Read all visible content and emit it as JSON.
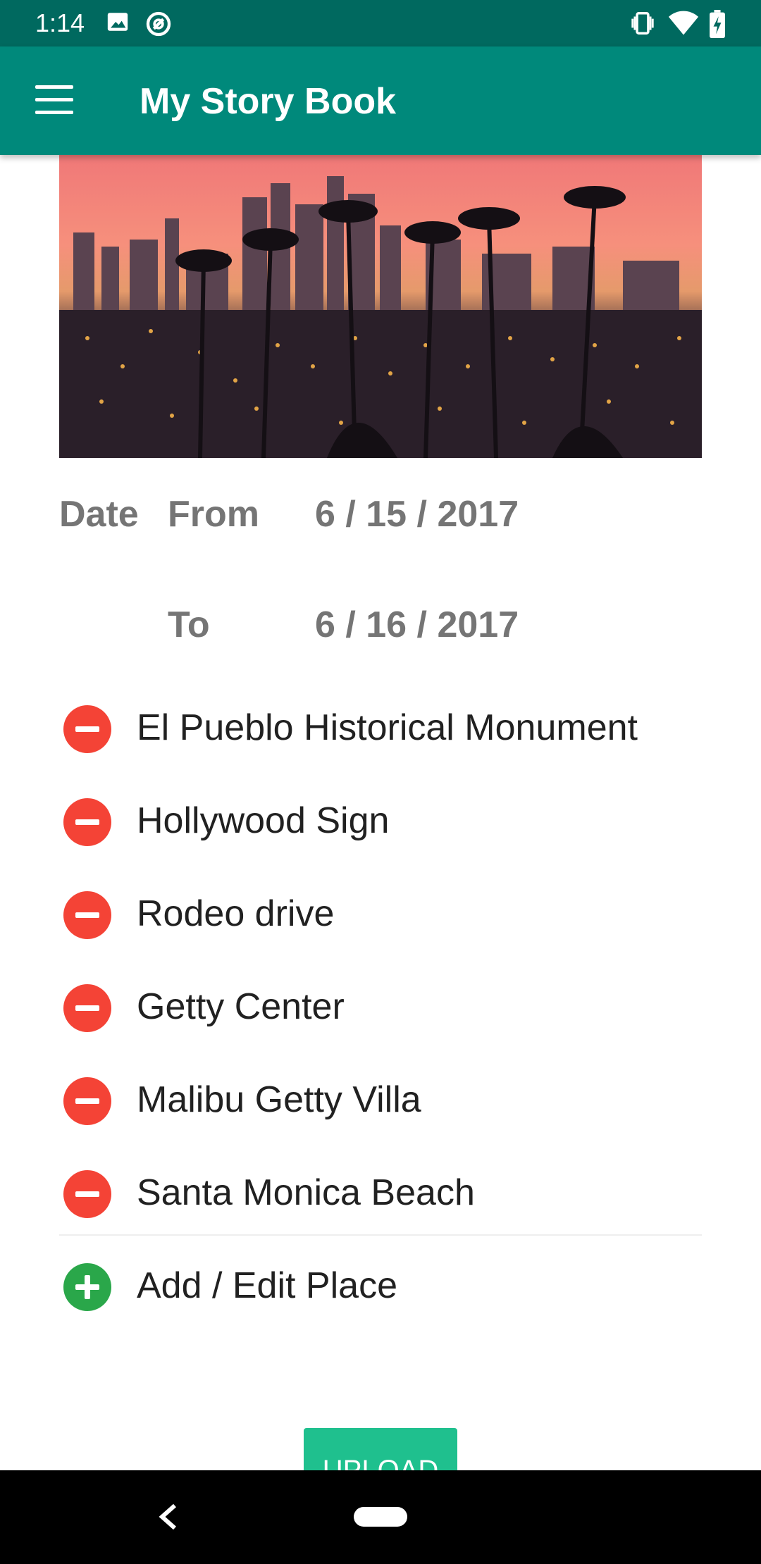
{
  "status_bar": {
    "time": "1:14",
    "left_icons": [
      "image-icon",
      "sync-icon"
    ],
    "right_icons": [
      "vibrate-icon",
      "wifi-icon",
      "battery-charging-icon"
    ]
  },
  "app_bar": {
    "title": "My Story Book",
    "menu_icon": "hamburger-menu-icon",
    "background": "#00897b",
    "status_background": "#00695f"
  },
  "dates": {
    "label": "Date",
    "from_label": "From",
    "from_value": "6 / 15 / 2017",
    "to_label": "To",
    "to_value": "6 / 16 / 2017"
  },
  "places": [
    {
      "name": "El Pueblo Historical Monument",
      "action": "remove"
    },
    {
      "name": "Hollywood Sign",
      "action": "remove"
    },
    {
      "name": "Rodeo drive",
      "action": "remove"
    },
    {
      "name": "Getty Center",
      "action": "remove"
    },
    {
      "name": "Malibu Getty Villa",
      "action": "remove"
    },
    {
      "name": "Santa Monica Beach",
      "action": "remove"
    }
  ],
  "add_place": {
    "label": "Add / Edit Place",
    "icon": "add-circle-icon"
  },
  "upload_button": {
    "label": "UPLOAD",
    "color": "#1fc08e"
  },
  "colors": {
    "remove": "#f44336",
    "add": "#2aa74a"
  },
  "nav_bar": {
    "back_icon": "back-icon",
    "home_icon": "home-pill-icon"
  }
}
